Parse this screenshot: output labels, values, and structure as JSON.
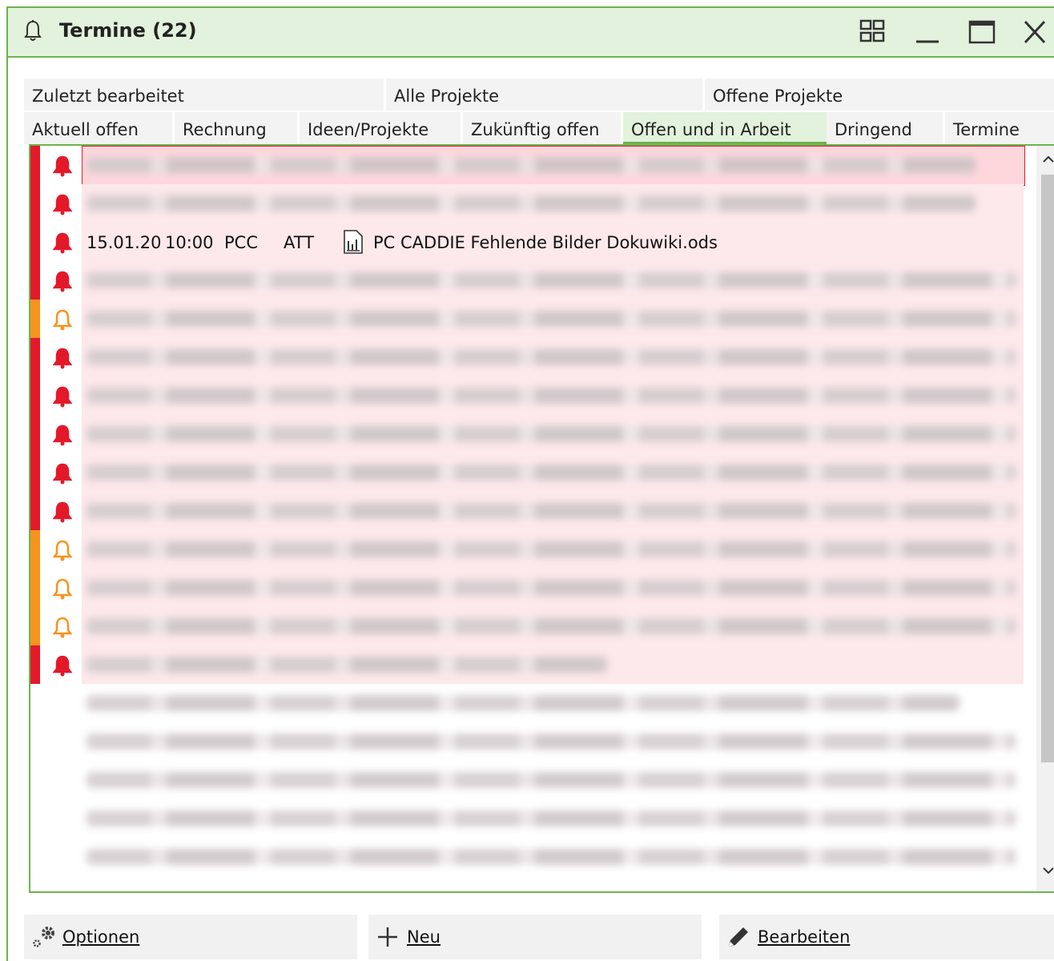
{
  "window": {
    "title": "Termine (22)"
  },
  "tabs_top": [
    {
      "label": "Zuletzt bearbeitet"
    },
    {
      "label": "Alle Projekte"
    },
    {
      "label": "Offene Projekte"
    }
  ],
  "tabs_bottom": [
    {
      "label": "Aktuell offen"
    },
    {
      "label": "Rechnung"
    },
    {
      "label": "Ideen/Projekte"
    },
    {
      "label": "Zukünftig offen"
    },
    {
      "label": "Offen und in Arbeit"
    },
    {
      "label": "Dringend"
    },
    {
      "label": "Termine"
    }
  ],
  "active_tab": "Offen und in Arbeit",
  "visible_row": {
    "date": "15.01.20",
    "time": "10:00",
    "code1": "PCC",
    "code2": "ATT",
    "file": "PC CADDIE Fehlende Bilder Dokuwiki.ods"
  },
  "buttons": {
    "options": "Optionen",
    "new": "Neu",
    "edit": "Bearbeiten"
  },
  "colors": {
    "accent_green": "#6db34f",
    "urgent_red": "#e3192a",
    "warning_orange": "#f7931e",
    "row_highlight": "#fde8ea"
  }
}
